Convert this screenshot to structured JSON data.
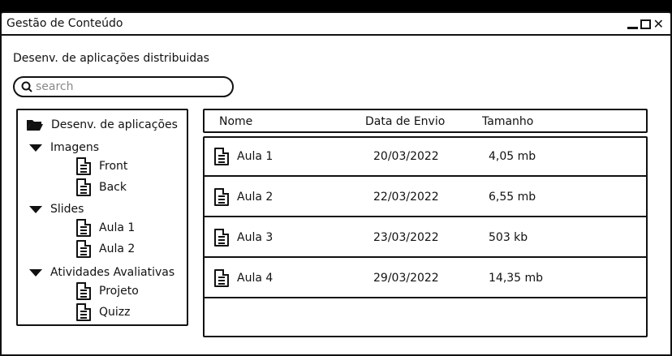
{
  "window": {
    "title": "Gestão de Conteúdo"
  },
  "breadcrumb": "Desenv. de aplicações distribuidas",
  "search": {
    "placeholder": "search",
    "value": ""
  },
  "tree": {
    "root": "Desenv. de aplicações",
    "groups": [
      {
        "label": "Imagens",
        "items": [
          "Front",
          "Back"
        ]
      },
      {
        "label": "Slides",
        "items": [
          "Aula 1",
          "Aula 2"
        ]
      },
      {
        "label": "Atividades Avaliativas",
        "items": [
          "Projeto",
          "Quizz"
        ]
      }
    ]
  },
  "table": {
    "columns": [
      "Nome",
      "Data de Envio",
      "Tamanho"
    ],
    "rows": [
      {
        "name": "Aula 1",
        "date": "20/03/2022",
        "size": "4,05 mb"
      },
      {
        "name": "Aula 2",
        "date": "22/03/2022",
        "size": "6,55 mb"
      },
      {
        "name": "Aula 3",
        "date": "23/03/2022",
        "size": "503 kb"
      },
      {
        "name": "Aula 4",
        "date": "29/03/2022",
        "size": "14,35 mb"
      }
    ]
  },
  "icons": {
    "minimize": "minimize-icon",
    "maximize": "maximize-icon",
    "close": "close-icon",
    "search": "search-icon",
    "folder": "folder-open-icon",
    "expand": "triangle-down-icon",
    "file": "document-icon"
  }
}
